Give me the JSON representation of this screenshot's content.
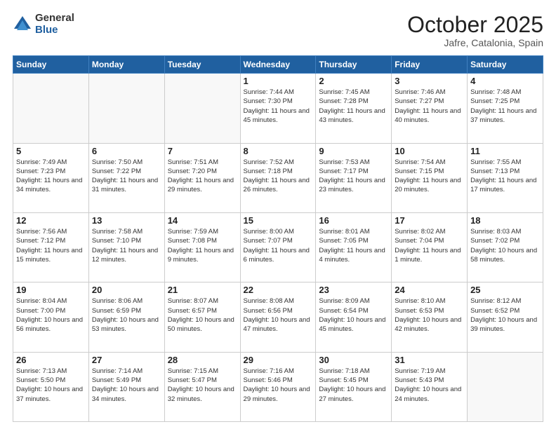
{
  "logo": {
    "general": "General",
    "blue": "Blue"
  },
  "title": "October 2025",
  "subtitle": "Jafre, Catalonia, Spain",
  "days_of_week": [
    "Sunday",
    "Monday",
    "Tuesday",
    "Wednesday",
    "Thursday",
    "Friday",
    "Saturday"
  ],
  "weeks": [
    [
      {
        "day": "",
        "info": ""
      },
      {
        "day": "",
        "info": ""
      },
      {
        "day": "",
        "info": ""
      },
      {
        "day": "1",
        "info": "Sunrise: 7:44 AM\nSunset: 7:30 PM\nDaylight: 11 hours\nand 45 minutes."
      },
      {
        "day": "2",
        "info": "Sunrise: 7:45 AM\nSunset: 7:28 PM\nDaylight: 11 hours\nand 43 minutes."
      },
      {
        "day": "3",
        "info": "Sunrise: 7:46 AM\nSunset: 7:27 PM\nDaylight: 11 hours\nand 40 minutes."
      },
      {
        "day": "4",
        "info": "Sunrise: 7:48 AM\nSunset: 7:25 PM\nDaylight: 11 hours\nand 37 minutes."
      }
    ],
    [
      {
        "day": "5",
        "info": "Sunrise: 7:49 AM\nSunset: 7:23 PM\nDaylight: 11 hours\nand 34 minutes."
      },
      {
        "day": "6",
        "info": "Sunrise: 7:50 AM\nSunset: 7:22 PM\nDaylight: 11 hours\nand 31 minutes."
      },
      {
        "day": "7",
        "info": "Sunrise: 7:51 AM\nSunset: 7:20 PM\nDaylight: 11 hours\nand 29 minutes."
      },
      {
        "day": "8",
        "info": "Sunrise: 7:52 AM\nSunset: 7:18 PM\nDaylight: 11 hours\nand 26 minutes."
      },
      {
        "day": "9",
        "info": "Sunrise: 7:53 AM\nSunset: 7:17 PM\nDaylight: 11 hours\nand 23 minutes."
      },
      {
        "day": "10",
        "info": "Sunrise: 7:54 AM\nSunset: 7:15 PM\nDaylight: 11 hours\nand 20 minutes."
      },
      {
        "day": "11",
        "info": "Sunrise: 7:55 AM\nSunset: 7:13 PM\nDaylight: 11 hours\nand 17 minutes."
      }
    ],
    [
      {
        "day": "12",
        "info": "Sunrise: 7:56 AM\nSunset: 7:12 PM\nDaylight: 11 hours\nand 15 minutes."
      },
      {
        "day": "13",
        "info": "Sunrise: 7:58 AM\nSunset: 7:10 PM\nDaylight: 11 hours\nand 12 minutes."
      },
      {
        "day": "14",
        "info": "Sunrise: 7:59 AM\nSunset: 7:08 PM\nDaylight: 11 hours\nand 9 minutes."
      },
      {
        "day": "15",
        "info": "Sunrise: 8:00 AM\nSunset: 7:07 PM\nDaylight: 11 hours\nand 6 minutes."
      },
      {
        "day": "16",
        "info": "Sunrise: 8:01 AM\nSunset: 7:05 PM\nDaylight: 11 hours\nand 4 minutes."
      },
      {
        "day": "17",
        "info": "Sunrise: 8:02 AM\nSunset: 7:04 PM\nDaylight: 11 hours\nand 1 minute."
      },
      {
        "day": "18",
        "info": "Sunrise: 8:03 AM\nSunset: 7:02 PM\nDaylight: 10 hours\nand 58 minutes."
      }
    ],
    [
      {
        "day": "19",
        "info": "Sunrise: 8:04 AM\nSunset: 7:00 PM\nDaylight: 10 hours\nand 56 minutes."
      },
      {
        "day": "20",
        "info": "Sunrise: 8:06 AM\nSunset: 6:59 PM\nDaylight: 10 hours\nand 53 minutes."
      },
      {
        "day": "21",
        "info": "Sunrise: 8:07 AM\nSunset: 6:57 PM\nDaylight: 10 hours\nand 50 minutes."
      },
      {
        "day": "22",
        "info": "Sunrise: 8:08 AM\nSunset: 6:56 PM\nDaylight: 10 hours\nand 47 minutes."
      },
      {
        "day": "23",
        "info": "Sunrise: 8:09 AM\nSunset: 6:54 PM\nDaylight: 10 hours\nand 45 minutes."
      },
      {
        "day": "24",
        "info": "Sunrise: 8:10 AM\nSunset: 6:53 PM\nDaylight: 10 hours\nand 42 minutes."
      },
      {
        "day": "25",
        "info": "Sunrise: 8:12 AM\nSunset: 6:52 PM\nDaylight: 10 hours\nand 39 minutes."
      }
    ],
    [
      {
        "day": "26",
        "info": "Sunrise: 7:13 AM\nSunset: 5:50 PM\nDaylight: 10 hours\nand 37 minutes."
      },
      {
        "day": "27",
        "info": "Sunrise: 7:14 AM\nSunset: 5:49 PM\nDaylight: 10 hours\nand 34 minutes."
      },
      {
        "day": "28",
        "info": "Sunrise: 7:15 AM\nSunset: 5:47 PM\nDaylight: 10 hours\nand 32 minutes."
      },
      {
        "day": "29",
        "info": "Sunrise: 7:16 AM\nSunset: 5:46 PM\nDaylight: 10 hours\nand 29 minutes."
      },
      {
        "day": "30",
        "info": "Sunrise: 7:18 AM\nSunset: 5:45 PM\nDaylight: 10 hours\nand 27 minutes."
      },
      {
        "day": "31",
        "info": "Sunrise: 7:19 AM\nSunset: 5:43 PM\nDaylight: 10 hours\nand 24 minutes."
      },
      {
        "day": "",
        "info": ""
      }
    ]
  ]
}
